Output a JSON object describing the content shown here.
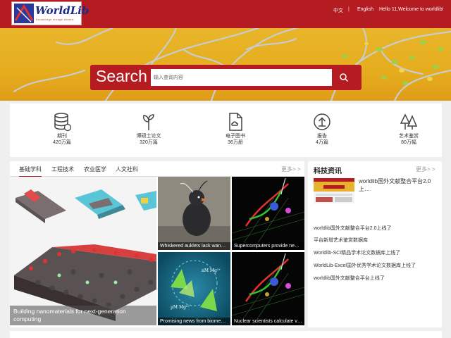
{
  "header": {
    "logo_text": "WorldLib",
    "logo_sub": "Knowledge enrage shared",
    "lang_cn": "中文",
    "separator": "|",
    "lang_en": "English",
    "greeting": "Hello 11,Welcome to worldlib!"
  },
  "search": {
    "title": "Search",
    "placeholder": "输入查询内容"
  },
  "categories": [
    {
      "label": "期刊",
      "count": "420万篇",
      "icon": "database-icon"
    },
    {
      "label": "博硕士论文",
      "count": "320万篇",
      "icon": "sprout-icon"
    },
    {
      "label": "电子图书",
      "count": "36万册",
      "icon": "cloud-file-icon"
    },
    {
      "label": "报告",
      "count": "4万篇",
      "icon": "upload-circle-icon"
    },
    {
      "label": "艺术鉴赏",
      "count": "80万幅",
      "icon": "trees-icon"
    }
  ],
  "tabs": [
    "基础学科",
    "工程技术",
    "农业医学",
    "人文社科"
  ],
  "more_label": "更多> >",
  "tiles": {
    "big": "Building nanomaterials for next-generation computing",
    "t1": "Whiskered auklets lack wan…",
    "t2": "Supercomputers provide ne…",
    "t3": "Promising news from biome…",
    "t4": "Nuclear scientists calculate v…"
  },
  "news": {
    "title": "科技资讯",
    "more_label": "更多> >",
    "featured": "worldlib国外文献整合平台2.0上…",
    "items": [
      "worldlib国外文献整合平台2.0上线了",
      "平台新增艺术鉴赏数据库",
      "Worldlib-SCI精品学术论文数据库上线了",
      "WorldLib-Excel国外优秀学术论文数据库上线了",
      "worldlib国外文献整合平台上线了"
    ]
  },
  "colors": {
    "brand_red": "#b41c22",
    "banner_yellow": "#e5ad1e"
  }
}
